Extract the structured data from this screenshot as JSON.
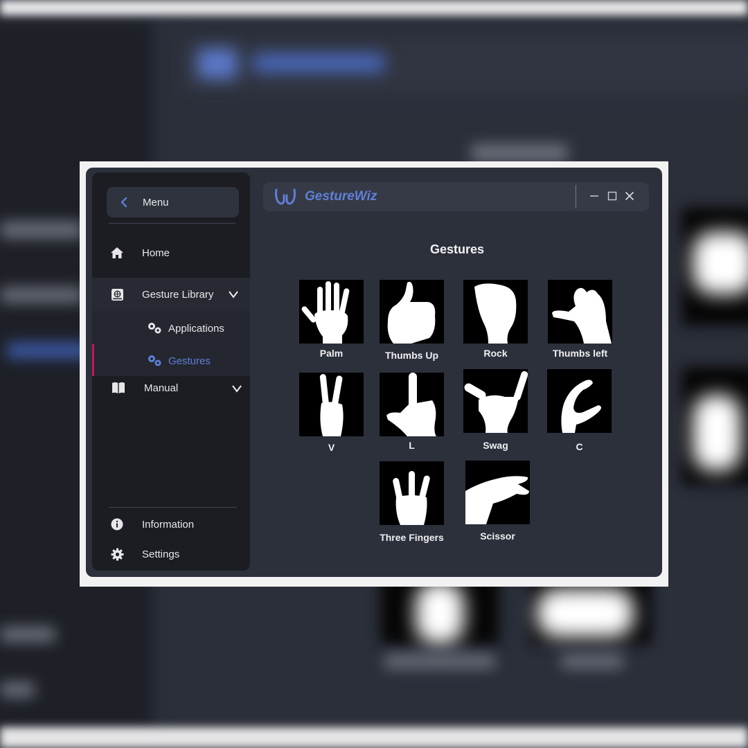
{
  "app": {
    "title": "GestureWiz"
  },
  "sidebar": {
    "menu_label": "Menu",
    "items": [
      {
        "label": "Home",
        "icon": "home-icon"
      },
      {
        "label": "Gesture Library",
        "icon": "book-globe-icon"
      },
      {
        "label": "Applications",
        "icon": "gears-icon"
      },
      {
        "label": "Gestures",
        "icon": "gears-icon",
        "active": true
      },
      {
        "label": "Manual",
        "icon": "open-book-icon"
      }
    ],
    "footer": [
      {
        "label": "Information",
        "icon": "info-icon"
      },
      {
        "label": "Settings",
        "icon": "gear-icon"
      }
    ]
  },
  "window_controls": [
    "minimize",
    "maximize",
    "close"
  ],
  "main": {
    "title": "Gestures",
    "gestures": [
      {
        "label": "Palm"
      },
      {
        "label": "Thumbs Up"
      },
      {
        "label": "Rock"
      },
      {
        "label": "Thumbs left"
      },
      {
        "label": "V"
      },
      {
        "label": "L"
      },
      {
        "label": "Swag"
      },
      {
        "label": "C"
      },
      {
        "label": "Three Fingers"
      },
      {
        "label": "Scissor"
      }
    ]
  },
  "colors": {
    "accent": "#5f80d8",
    "active_bar": "#c2185b",
    "sidebar_bg": "#1b1d23",
    "window_bg": "#2c303b"
  }
}
